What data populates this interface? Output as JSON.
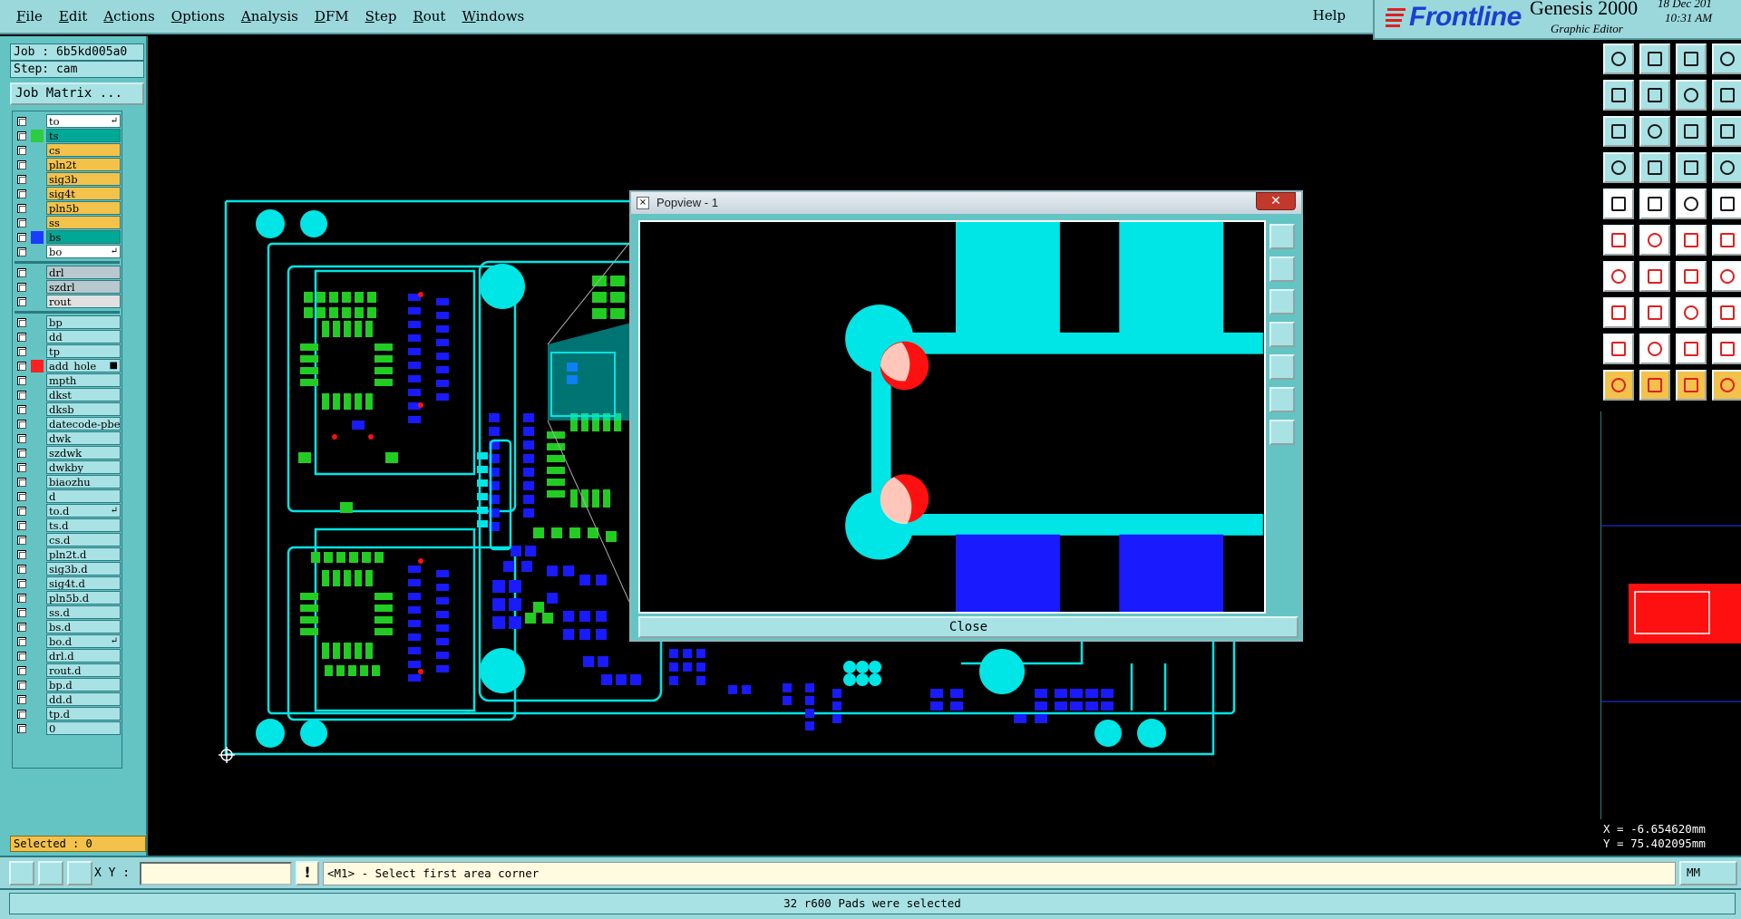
{
  "menu": {
    "items": [
      "File",
      "Edit",
      "Actions",
      "Options",
      "Analysis",
      "DFM",
      "Step",
      "Rout",
      "Windows"
    ],
    "help": "Help"
  },
  "brand": {
    "logo": "Frontline",
    "product": "Genesis 2000",
    "subtitle": "Graphic Editor",
    "date": "18 Dec 201",
    "time": "10:31 AM"
  },
  "job": {
    "job_label": "Job : 6b5kd005a0",
    "step_label": "Step: cam",
    "matrix_button": "Job Matrix ..."
  },
  "layers": {
    "board": [
      {
        "name": "to",
        "color": "#ffffff",
        "swatch": "",
        "mark": "↵"
      },
      {
        "name": "ts",
        "color": "#00a896",
        "swatch": "#2ecc40",
        "mark": ""
      },
      {
        "name": "cs",
        "color": "#f3c24a",
        "swatch": "",
        "mark": ""
      },
      {
        "name": "pln2t",
        "color": "#f3c24a",
        "swatch": "",
        "mark": ""
      },
      {
        "name": "sig3b",
        "color": "#f3c24a",
        "swatch": "",
        "mark": ""
      },
      {
        "name": "sig4t",
        "color": "#f3c24a",
        "swatch": "",
        "mark": ""
      },
      {
        "name": "pln5b",
        "color": "#f3c24a",
        "swatch": "",
        "mark": ""
      },
      {
        "name": "ss",
        "color": "#f3c24a",
        "swatch": "",
        "mark": ""
      },
      {
        "name": "bs",
        "color": "#00a896",
        "swatch": "#1a3cff",
        "mark": ""
      },
      {
        "name": "bo",
        "color": "#ffffff",
        "swatch": "",
        "mark": "↵"
      }
    ],
    "drill": [
      {
        "name": "drl",
        "color": "#b8c8cc",
        "swatch": "",
        "mark": ""
      },
      {
        "name": "szdrl",
        "color": "#b8c8cc",
        "swatch": "",
        "mark": ""
      },
      {
        "name": "rout",
        "color": "#e0e0e0",
        "swatch": "",
        "mark": ""
      }
    ],
    "misc": [
      {
        "name": "bp",
        "color": "#a8e2e4",
        "swatch": "",
        "mark": ""
      },
      {
        "name": "dd",
        "color": "#a8e2e4",
        "swatch": "",
        "mark": ""
      },
      {
        "name": "tp",
        "color": "#a8e2e4",
        "swatch": "",
        "mark": ""
      },
      {
        "name": "add_hole",
        "color": "#a8e2e4",
        "swatch": "#ff2020",
        "mark": "■"
      },
      {
        "name": "mpth",
        "color": "#a8e2e4",
        "swatch": "",
        "mark": ""
      },
      {
        "name": "dkst",
        "color": "#a8e2e4",
        "swatch": "",
        "mark": ""
      },
      {
        "name": "dksb",
        "color": "#a8e2e4",
        "swatch": "",
        "mark": ""
      },
      {
        "name": "datecode-pbe",
        "color": "#a8e2e4",
        "swatch": "",
        "mark": ""
      },
      {
        "name": "dwk",
        "color": "#a8e2e4",
        "swatch": "",
        "mark": ""
      },
      {
        "name": "szdwk",
        "color": "#a8e2e4",
        "swatch": "",
        "mark": ""
      },
      {
        "name": "dwkby",
        "color": "#a8e2e4",
        "swatch": "",
        "mark": ""
      },
      {
        "name": "biaozhu",
        "color": "#a8e2e4",
        "swatch": "",
        "mark": ""
      },
      {
        "name": "d",
        "color": "#a8e2e4",
        "swatch": "",
        "mark": ""
      },
      {
        "name": "to.d",
        "color": "#a8e2e4",
        "swatch": "",
        "mark": "↵"
      },
      {
        "name": "ts.d",
        "color": "#a8e2e4",
        "swatch": "",
        "mark": ""
      },
      {
        "name": "cs.d",
        "color": "#a8e2e4",
        "swatch": "",
        "mark": ""
      },
      {
        "name": "pln2t.d",
        "color": "#a8e2e4",
        "swatch": "",
        "mark": ""
      },
      {
        "name": "sig3b.d",
        "color": "#a8e2e4",
        "swatch": "",
        "mark": ""
      },
      {
        "name": "sig4t.d",
        "color": "#a8e2e4",
        "swatch": "",
        "mark": ""
      },
      {
        "name": "pln5b.d",
        "color": "#a8e2e4",
        "swatch": "",
        "mark": ""
      },
      {
        "name": "ss.d",
        "color": "#a8e2e4",
        "swatch": "",
        "mark": ""
      },
      {
        "name": "bs.d",
        "color": "#a8e2e4",
        "swatch": "",
        "mark": ""
      },
      {
        "name": "bo.d",
        "color": "#a8e2e4",
        "swatch": "",
        "mark": "↵"
      },
      {
        "name": "drl.d",
        "color": "#a8e2e4",
        "swatch": "",
        "mark": ""
      },
      {
        "name": "rout.d",
        "color": "#a8e2e4",
        "swatch": "",
        "mark": ""
      },
      {
        "name": "bp.d",
        "color": "#a8e2e4",
        "swatch": "",
        "mark": ""
      },
      {
        "name": "dd.d",
        "color": "#a8e2e4",
        "swatch": "",
        "mark": ""
      },
      {
        "name": "tp.d",
        "color": "#a8e2e4",
        "swatch": "",
        "mark": ""
      },
      {
        "name": "0",
        "color": "#a8e2e4",
        "swatch": "",
        "mark": ""
      }
    ]
  },
  "selected": "Selected : 0",
  "popview": {
    "title": "Popview - 1",
    "close_x": "✕",
    "close_button": "Close"
  },
  "coords": {
    "x": "X = -6.654620mm",
    "y": "Y = 75.402095mm"
  },
  "command": {
    "xy_label": "X Y :",
    "xy_value": "",
    "bang": "!",
    "prompt": "<M1> - Select first area corner",
    "units": "MM"
  },
  "status": "32 r600 Pads were selected",
  "colors": {
    "outline": "#00e5e5",
    "top_pads": "#22cc22",
    "bottom_pads": "#1a1aff",
    "highlight": "#ff1010",
    "panel": "#64c4c4",
    "menubar": "#9ad8dc"
  },
  "icons": {
    "right_toolbar": [
      "zoom-home-icon",
      "zoom-in-icon",
      "zoom-out-icon",
      "zoom-window-icon",
      "pan-left-icon",
      "pan-right-icon",
      "fit-one-to-two-icon",
      "scroll-icon",
      "zoom-fit-icon",
      "center-icon",
      "scale-icon",
      "help-icon",
      "measure-icon",
      "connection-icon",
      "route-icon",
      "flip-icon",
      "add-pad-icon",
      "add-line-icon",
      "add-surface-icon",
      "add-text-icon",
      "snap-pad-icon",
      "cross-icon",
      "diagonal-icon",
      "snap-red-icon",
      "edit-arc-icon",
      "slope-icon",
      "rotate-icon",
      "red-pad-icon",
      "red-rect-icon",
      "red-line-icon",
      "frame-icon",
      "multi-icon",
      "triangle-icon",
      "triangle-out-icon",
      "triangle-fill-icon",
      "triangle-edit-icon",
      "select-arrow-icon",
      "select-box-icon",
      "select-net-icon",
      "select-multi-icon"
    ]
  }
}
